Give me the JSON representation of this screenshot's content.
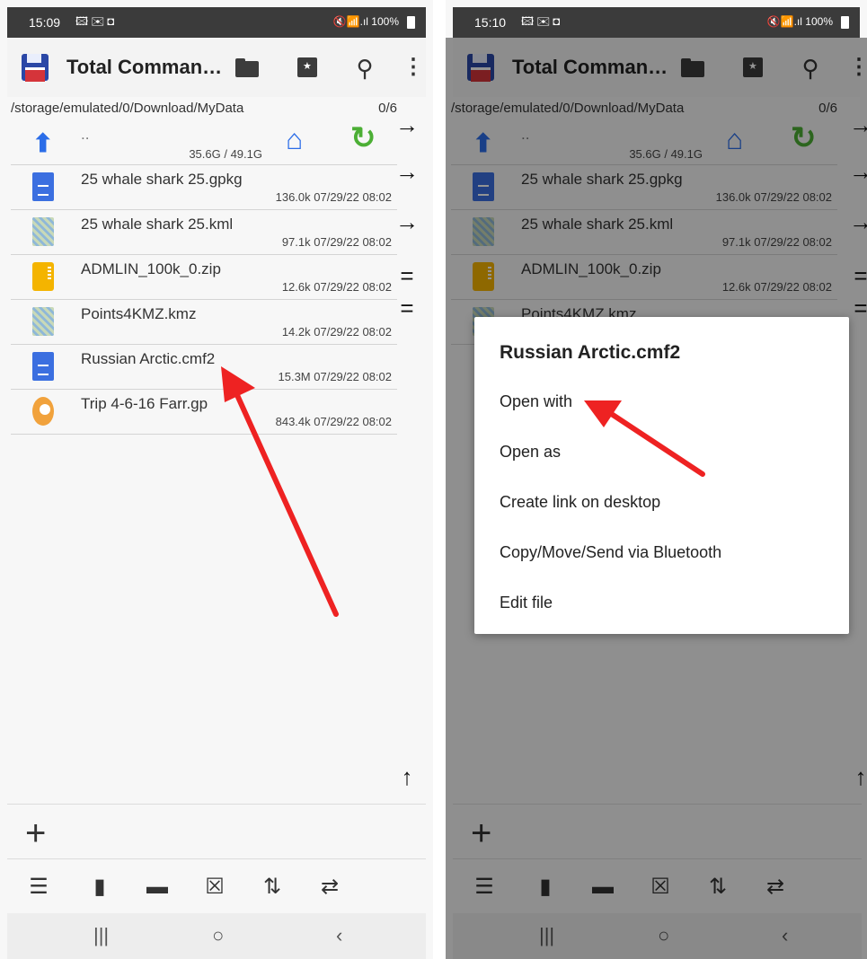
{
  "status_left": {
    "time": "15:09",
    "notifications": "🖾✉◘",
    "system": "🔇📶.ıl 100%"
  },
  "status_right": {
    "time": "15:10",
    "notifications": "🖾✉◘",
    "system": "🔇📶.ıl 100%"
  },
  "app": {
    "title": "Total Comman…"
  },
  "path": {
    "text": "/storage/emulated/0/Download/MyData",
    "count": "0/6"
  },
  "updir": {
    "name": "..",
    "space": "35.6G / 49.1G"
  },
  "files": [
    {
      "name": "25 whale shark 25.gpkg",
      "meta": "136.0k 07/29/22 08:02",
      "icon": "document-icon"
    },
    {
      "name": "25 whale shark 25.kml",
      "meta": "97.1k 07/29/22 08:02",
      "icon": "map-icon"
    },
    {
      "name": "ADMLIN_100k_0.zip",
      "meta": "12.6k 07/29/22 08:02",
      "icon": "zip-folder-icon"
    },
    {
      "name": "Points4KMZ.kmz",
      "meta": "14.2k 07/29/22 08:02",
      "icon": "map-icon"
    },
    {
      "name": "Russian Arctic.cmf2",
      "meta": "15.3M 07/29/22 08:02",
      "icon": "document-icon"
    },
    {
      "name": "Trip 4-6-16 Farr.gp",
      "meta": "843.4k 07/29/22 08:02",
      "icon": "location-pin-icon"
    }
  ],
  "compare_buttons": [
    "→",
    "→",
    "→",
    "=",
    "="
  ],
  "scroll_up": "↑",
  "plus": "+",
  "toolbar_icons": [
    "select-list-icon",
    "new-file-icon",
    "pack-zip-icon",
    "delete-icon",
    "sort-icon",
    "swap-panels-icon"
  ],
  "context_menu": {
    "title": "Russian Arctic.cmf2",
    "items": [
      "Open with",
      "Open as",
      "Create link on desktop",
      "Copy/Move/Send via Bluetooth",
      "Edit file"
    ]
  },
  "colors": {
    "accent_blue": "#2b6de8",
    "refresh_green": "#4caf35",
    "annotation_red": "#ee2222"
  }
}
